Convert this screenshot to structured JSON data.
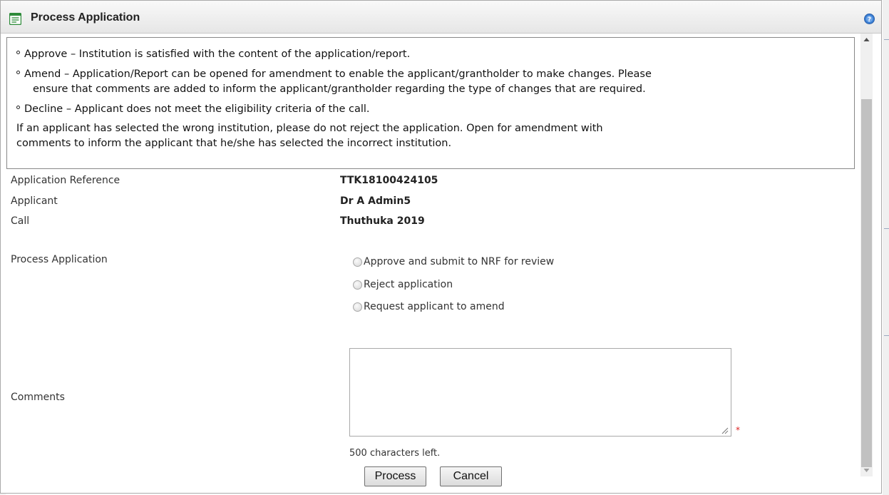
{
  "dialog": {
    "title": "Process Application"
  },
  "info": {
    "approve": "Approve – Institution is satisfied with the content of the application/report.",
    "amend_line1": "Amend – Application/Report can be opened for amendment to enable the applicant/grantholder to make changes. Please",
    "amend_line2": "ensure that comments are added to inform the applicant/grantholder regarding the type of changes that are required.",
    "decline": "Decline – Applicant does not meet the eligibility criteria of the call.",
    "note_line1": "If an applicant has selected the wrong institution, please do not reject the application. Open for amendment with",
    "note_line2": "comments to inform the applicant that he/she has selected the incorrect institution."
  },
  "fields": {
    "reference_label": "Application Reference",
    "reference_value": "TTK18100424105",
    "applicant_label": "Applicant",
    "applicant_value": "Dr A Admin5",
    "call_label": "Call",
    "call_value": "Thuthuka 2019",
    "process_label": "Process Application",
    "comments_label": "Comments"
  },
  "options": [
    {
      "label": "Approve and submit to NRF for review",
      "selected": false
    },
    {
      "label": "Reject application",
      "selected": false
    },
    {
      "label": "Request applicant to amend",
      "selected": false
    }
  ],
  "comments": {
    "value": "",
    "required_mark": "*",
    "chars_left": "500 characters left."
  },
  "buttons": {
    "process": "Process",
    "cancel": "Cancel"
  },
  "colors": {
    "required": "#d22222",
    "help_icon": "#3b7fd4",
    "title_icon": "#2e8b3a"
  }
}
